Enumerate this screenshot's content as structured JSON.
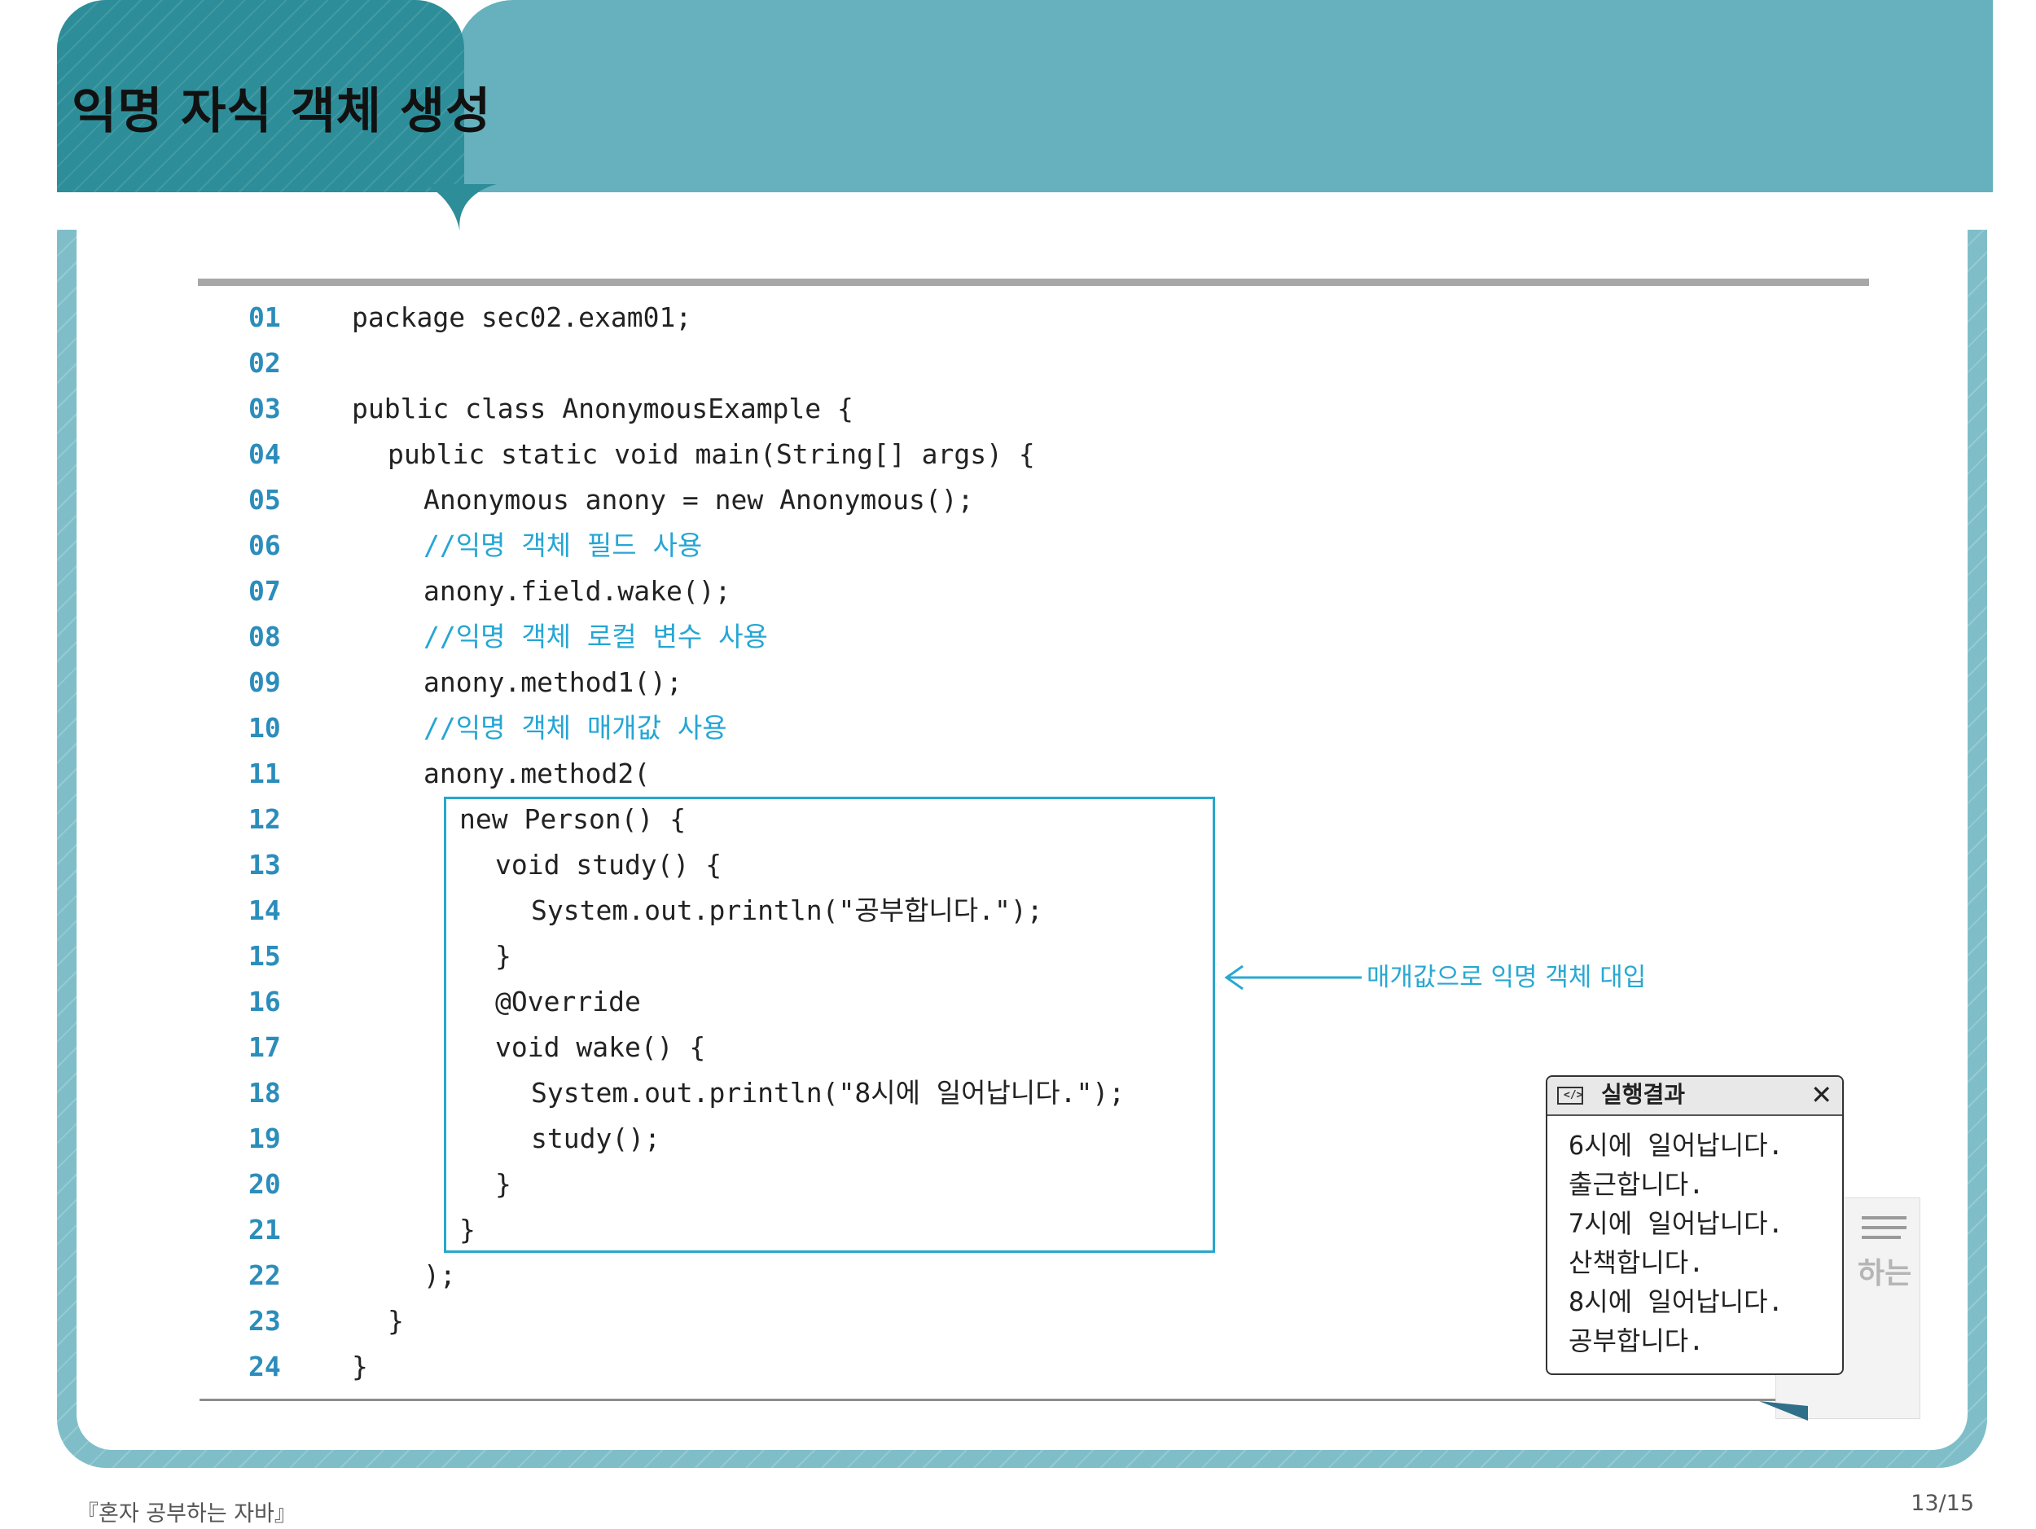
{
  "slide": {
    "title": "익명 자식 객체 생성",
    "footer_book": "『혼자 공부하는 자바』",
    "page_number": "13/15"
  },
  "code": {
    "lines": [
      {
        "num": "01",
        "text": "package sec02.exam01;",
        "indent": 0,
        "comment": false
      },
      {
        "num": "02",
        "text": "",
        "indent": 0,
        "comment": false
      },
      {
        "num": "03",
        "text": "public class AnonymousExample {",
        "indent": 0,
        "comment": false
      },
      {
        "num": "04",
        "text": "public static void main(String[] args) {",
        "indent": 1,
        "comment": false
      },
      {
        "num": "05",
        "text": "Anonymous anony = new Anonymous();",
        "indent": 2,
        "comment": false
      },
      {
        "num": "06",
        "text": "//익명 객체 필드 사용",
        "indent": 2,
        "comment": true
      },
      {
        "num": "07",
        "text": "anony.field.wake();",
        "indent": 2,
        "comment": false
      },
      {
        "num": "08",
        "text": "//익명 객체 로컬 변수 사용",
        "indent": 2,
        "comment": true
      },
      {
        "num": "09",
        "text": "anony.method1();",
        "indent": 2,
        "comment": false
      },
      {
        "num": "10",
        "text": "//익명 객체 매개값 사용",
        "indent": 2,
        "comment": true
      },
      {
        "num": "11",
        "text": "anony.method2(",
        "indent": 2,
        "comment": false
      },
      {
        "num": "12",
        "text": "new Person() {",
        "indent": 3,
        "comment": false
      },
      {
        "num": "13",
        "text": "void study() {",
        "indent": 4,
        "comment": false
      },
      {
        "num": "14",
        "text": "System.out.println(\"공부합니다.\");",
        "indent": 5,
        "comment": false
      },
      {
        "num": "15",
        "text": "}",
        "indent": 4,
        "comment": false
      },
      {
        "num": "16",
        "text": "@Override",
        "indent": 4,
        "comment": false
      },
      {
        "num": "17",
        "text": "void wake() {",
        "indent": 4,
        "comment": false
      },
      {
        "num": "18",
        "text": "System.out.println(\"8시에 일어납니다.\");",
        "indent": 5,
        "comment": false
      },
      {
        "num": "19",
        "text": "study();",
        "indent": 5,
        "comment": false
      },
      {
        "num": "20",
        "text": "}",
        "indent": 4,
        "comment": false
      },
      {
        "num": "21",
        "text": "}",
        "indent": 3,
        "comment": false
      },
      {
        "num": "22",
        "text": ");",
        "indent": 2,
        "comment": false
      },
      {
        "num": "23",
        "text": "}",
        "indent": 1,
        "comment": false
      },
      {
        "num": "24",
        "text": "}",
        "indent": 0,
        "comment": false
      }
    ],
    "annotation": "매개값으로 익명 객체 대입"
  },
  "output_window": {
    "title": "실행결과",
    "icon": "console-icon",
    "close_icon": "close-icon",
    "close_symbol": "✕",
    "lines": [
      "6시에 일어납니다.",
      "출근합니다.",
      "7시에 일어납니다.",
      "산책합니다.",
      "8시에 일어납니다.",
      "공부합니다."
    ]
  },
  "colors": {
    "header_dark": "#2d8e99",
    "header_light": "#66b1bd",
    "frame": "#7fbec8",
    "line_number": "#2b8dbb",
    "comment": "#25a6d4",
    "highlight_box": "#27a7cc"
  }
}
